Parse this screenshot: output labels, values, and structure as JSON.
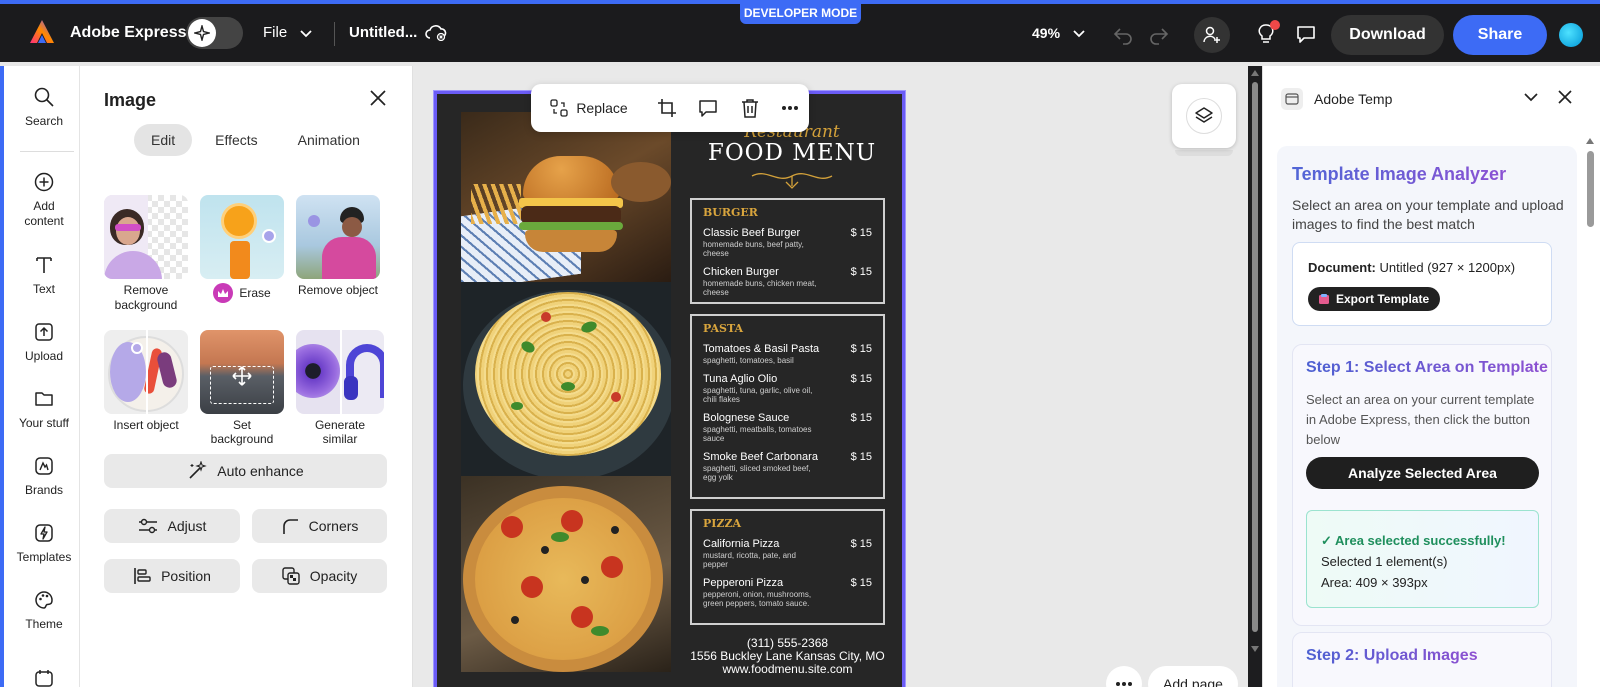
{
  "topbar": {
    "app_name": "Adobe Express",
    "file_label": "File",
    "doc_title": "Untitled...",
    "dev_mode": "DEVELOPER MODE",
    "zoom": "49%",
    "download_label": "Download",
    "share_label": "Share"
  },
  "rail": {
    "items": [
      {
        "label": "Search",
        "icon": "search-icon"
      },
      {
        "label": "Add\ncontent",
        "icon": "plus-circle-icon"
      },
      {
        "label": "Text",
        "icon": "text-icon"
      },
      {
        "label": "Upload",
        "icon": "upload-icon"
      },
      {
        "label": "Your stuff",
        "icon": "folder-icon"
      },
      {
        "label": "Brands",
        "icon": "brand-icon"
      },
      {
        "label": "Templates",
        "icon": "templates-icon"
      },
      {
        "label": "Theme",
        "icon": "palette-icon"
      }
    ]
  },
  "panel": {
    "title": "Image",
    "tabs": [
      "Edit",
      "Effects",
      "Animation"
    ],
    "tools": {
      "remove_bg": "Remove\nbackground",
      "erase": "Erase",
      "remove_object": "Remove object",
      "insert_object": "Insert object",
      "set_background": "Set background",
      "generate_similar": "Generate similar"
    },
    "auto_enhance": "Auto enhance",
    "adjust": "Adjust",
    "corners": "Corners",
    "position": "Position",
    "opacity": "Opacity"
  },
  "canvas": {
    "replace_label": "Replace",
    "add_page": "Add page",
    "menu": {
      "restaurant": "Restaurant",
      "title": "FOOD MENU",
      "burger": {
        "category": "BURGER",
        "items": [
          {
            "name": "Classic Beef Burger",
            "price": "$ 15",
            "desc": "homemade buns, beef patty, cheese"
          },
          {
            "name": "Chicken Burger",
            "price": "$ 15",
            "desc": "homemade buns, chicken meat, cheese"
          }
        ]
      },
      "pasta": {
        "category": "PASTA",
        "items": [
          {
            "name": "Tomatoes & Basil Pasta",
            "price": "$ 15",
            "desc": "spaghetti, tomatoes, basil"
          },
          {
            "name": "Tuna Aglio Olio",
            "price": "$ 15",
            "desc": "spaghetti, tuna, garlic, olive oil, chili flakes"
          },
          {
            "name": "Bolognese Sauce",
            "price": "$ 15",
            "desc": "spaghetti, meatballs, tomatoes sauce"
          },
          {
            "name": "Smoke Beef Carbonara",
            "price": "$ 15",
            "desc": "spaghetti, sliced smoked beef, egg yolk"
          }
        ]
      },
      "pizza": {
        "category": "PIZZA",
        "items": [
          {
            "name": "California Pizza",
            "price": "$ 15",
            "desc": "mustard, ricotta, pate, and pepper"
          },
          {
            "name": "Pepperoni Pizza",
            "price": "$ 15",
            "desc": "pepperoni, onion, mushrooms, green peppers, tomato sauce."
          }
        ]
      },
      "phone": "(311) 555-2368",
      "address": "1556 Buckley Lane Kansas City, MO",
      "website": "www.foodmenu.site.com"
    }
  },
  "right_panel": {
    "title": "Adobe Temp",
    "analyzer_title": "Template Image Analyzer",
    "analyzer_desc": "Select an area on your template and upload images to find the best match",
    "document_label": "Document:",
    "document_value": "Untitled (927 × 1200px)",
    "export_label": "Export Template",
    "step1_title": "Step 1: Select Area on Template",
    "step1_desc": "Select an area on your current template in Adobe Express, then click the button below",
    "analyze_label": "Analyze Selected Area",
    "success_title": "✓ Area selected successfully!",
    "success_line1": "Selected 1 element(s)",
    "success_line2": "Area: 409 × 393px",
    "step2_title": "Step 2: Upload Images"
  },
  "colors": {
    "accent": "#3d6bf5",
    "selection": "#6b5cf6",
    "gold": "#d9a53d",
    "success": "#1f8f5d"
  }
}
